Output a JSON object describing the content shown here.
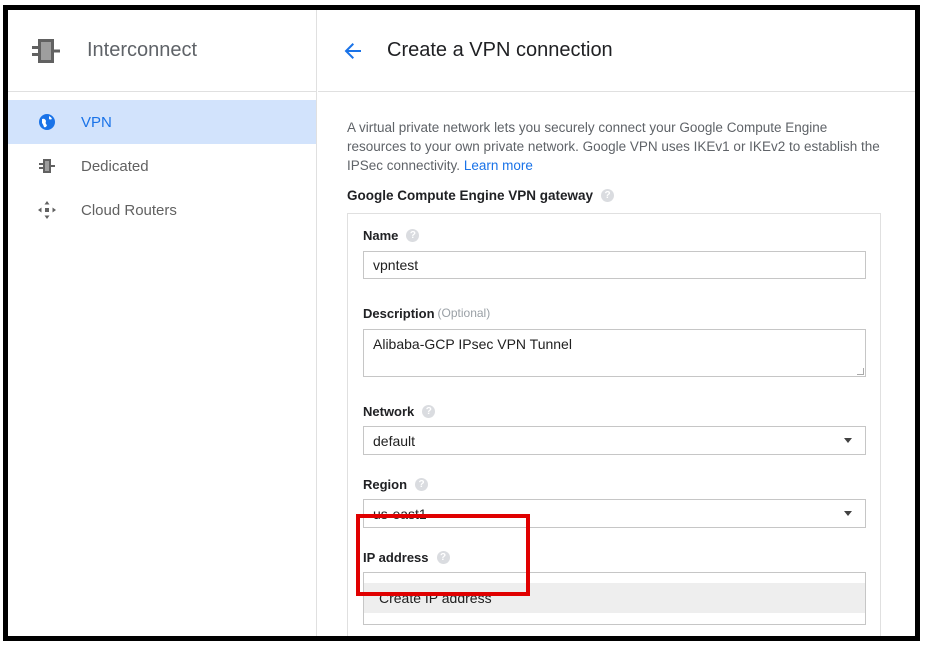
{
  "sidebar": {
    "title": "Interconnect",
    "items": [
      {
        "label": "VPN",
        "icon": "globe-icon",
        "active": true
      },
      {
        "label": "Dedicated",
        "icon": "interconnect-icon",
        "active": false
      },
      {
        "label": "Cloud Routers",
        "icon": "router-icon",
        "active": false
      }
    ]
  },
  "header": {
    "title": "Create a VPN connection"
  },
  "intro": {
    "text": "A virtual private network lets you securely connect your Google Compute Engine resources to your own private network. Google VPN uses IKEv1 or IKEv2 to establish the IPSec connectivity.",
    "link": "Learn more"
  },
  "gateway": {
    "section_title": "Google Compute Engine VPN gateway",
    "name_label": "Name",
    "name_value": "vpntest",
    "description_label": "Description",
    "description_optional": "(Optional)",
    "description_value": "Alibaba-GCP IPsec VPN Tunnel",
    "network_label": "Network",
    "network_value": "default",
    "region_label": "Region",
    "region_value": "us-east1",
    "ip_label": "IP address",
    "ip_option": "Create IP address"
  },
  "colors": {
    "accent": "#1a73e8",
    "active_bg": "#d2e3fc",
    "highlight": "#e00000"
  }
}
